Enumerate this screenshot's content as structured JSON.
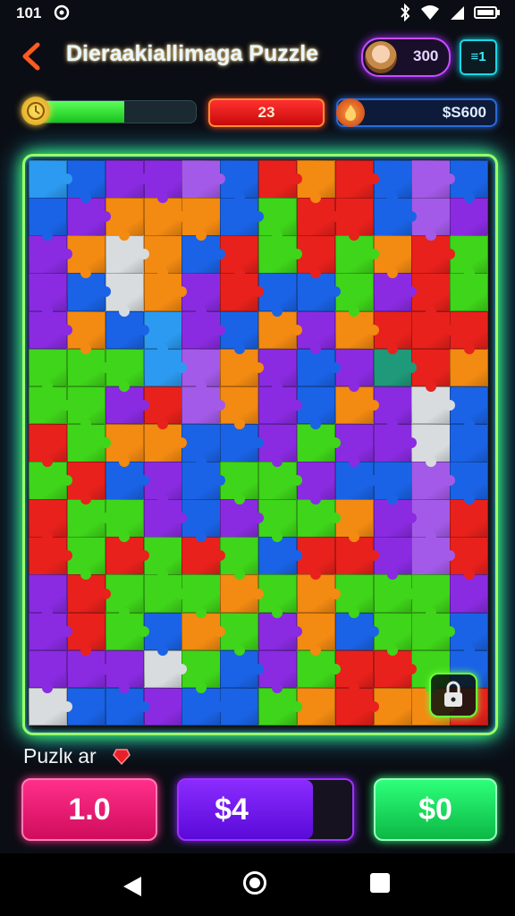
{
  "status_bar": {
    "time": "101",
    "icons": [
      "notification-icon",
      "bluetooth-icon",
      "wifi-icon",
      "signal-icon",
      "battery-icon"
    ]
  },
  "header": {
    "title": "Dieraakiallimaga Puzzle",
    "user_score": "300",
    "menu_label": "≡1"
  },
  "stats": {
    "progress_fraction": 0.55,
    "moves": "23",
    "score": "$S600"
  },
  "board": {
    "columns": 12,
    "rows": 15,
    "palette": {
      "R": "#e8211c",
      "G": "#3fd51a",
      "B": "#1a63e6",
      "P": "#8a2be2",
      "O": "#f38a12",
      "W": "#d8dcde",
      "L": "#a45ae8",
      "T": "#1e9a7a",
      "C": "#2c9af0"
    },
    "pieces": [
      "CBPPLBRORBLB",
      "BPOOOBGRRBLP",
      "POWOBRGRGORG",
      "PBWOPRBBGPRG",
      "POBCPBOPORRR",
      "GGGCLOPBPTRO",
      "GGPRLOPBOPWB",
      "RGOOBBPGPPWB",
      "GRBPBGGPBBLB",
      "RGGPBPGGOPLR",
      "RGRGRGBRRPLR",
      "PRGGGOGOGGGP",
      "PRGBOGPOBGGB",
      "PPPWGBPGRRGB",
      "WBBPBBGOROOR"
    ]
  },
  "footer": {
    "section_label": "Puzlк ar",
    "btn_left": "1.0",
    "btn_mid": "$4",
    "btn_right": "$0"
  }
}
